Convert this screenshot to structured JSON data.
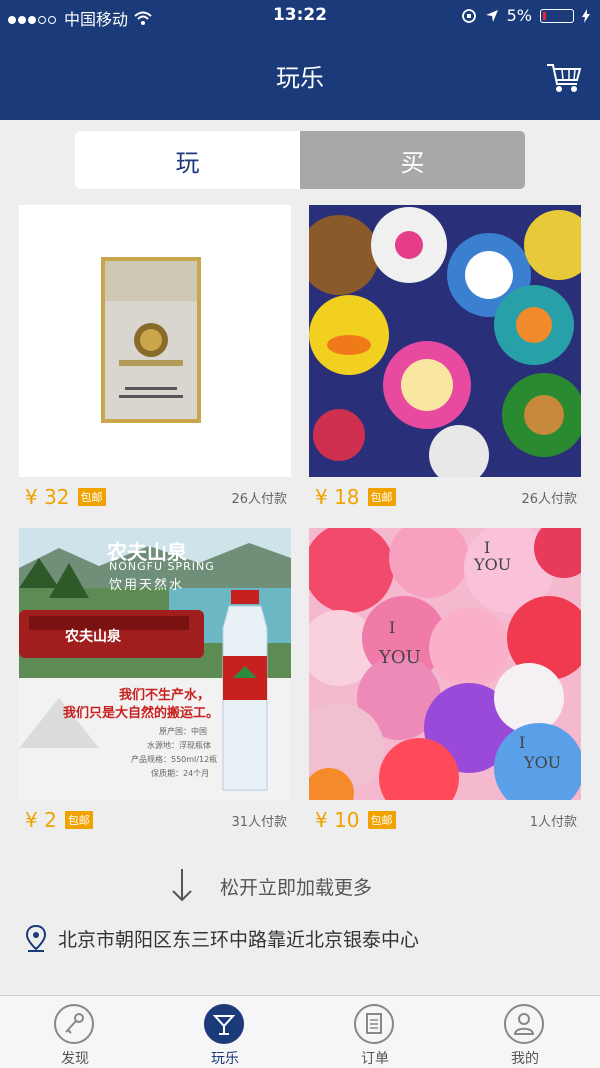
{
  "status_bar": {
    "carrier": "中国移动",
    "time": "13:22",
    "battery": "5%"
  },
  "header": {
    "title": "玩乐"
  },
  "segment": {
    "play": "玩",
    "buy": "买"
  },
  "products": [
    {
      "price": "¥ 32",
      "badge": "包邮",
      "paid": "26人付款"
    },
    {
      "price": "¥ 18",
      "badge": "包邮",
      "paid": "26人付款"
    },
    {
      "price": "¥ 2",
      "badge": "包邮",
      "paid": "31人付款"
    },
    {
      "price": "¥ 10",
      "badge": "包邮",
      "paid": "1人付款"
    }
  ],
  "water_ad": {
    "brand": "农夫山泉",
    "brand_en": "NONGFU SPRING",
    "slogan": "饮用天然水",
    "line1": "我们不生产水，",
    "line2": "我们只是大自然的搬运工。",
    "spec1": "原产国：中国",
    "spec2": "水源地：浮现瓶体",
    "spec3": "产品规格：550ml/12瓶",
    "spec4": "保质期：24个月"
  },
  "load_more": "松开立即加载更多",
  "location": "北京市朝阳区东三环中路靠近北京银泰中心",
  "tabbar": {
    "discover": "发现",
    "play": "玩乐",
    "orders": "订单",
    "mine": "我的"
  }
}
